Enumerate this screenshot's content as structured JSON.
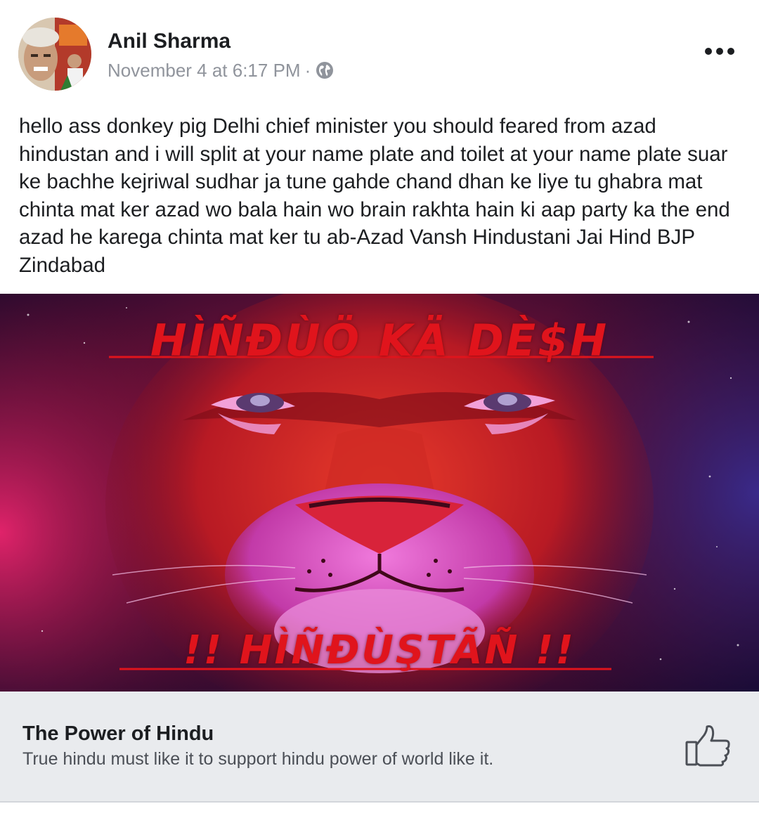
{
  "post": {
    "author": "Anil Sharma",
    "timestamp": "November 4 at 6:17 PM",
    "separator": "·",
    "privacy_icon": "globe-icon",
    "more_icon": "more-options-icon",
    "text": "hello ass donkey pig Delhi chief minister you should feared from azad hindustan and i will split at your name plate and toilet at your name plate suar ke bachhe kejriwal sudhar ja tune gahde chand dhan ke liye tu ghabra mat chinta mat ker azad wo bala hain wo brain rakhta hain ki aap party ka the end azad he karega chinta mat ker tu ab-Azad Vansh Hindustani Jai Hind BJP Zindabad"
  },
  "image": {
    "caption_top": "HÌÑĐÙÖ KÄ DÈ$H",
    "caption_bottom": "!! HÌÑĐÙŞTÃÑ !!",
    "accent_color": "#e0141c"
  },
  "page_card": {
    "name": "The Power of Hindu",
    "description": "True hindu must like it to support hindu power of world like it.",
    "action_icon": "thumbs-up-icon"
  },
  "colors": {
    "text_primary": "#1c1e21",
    "text_secondary": "#90949c",
    "card_background": "#e9ebee"
  }
}
